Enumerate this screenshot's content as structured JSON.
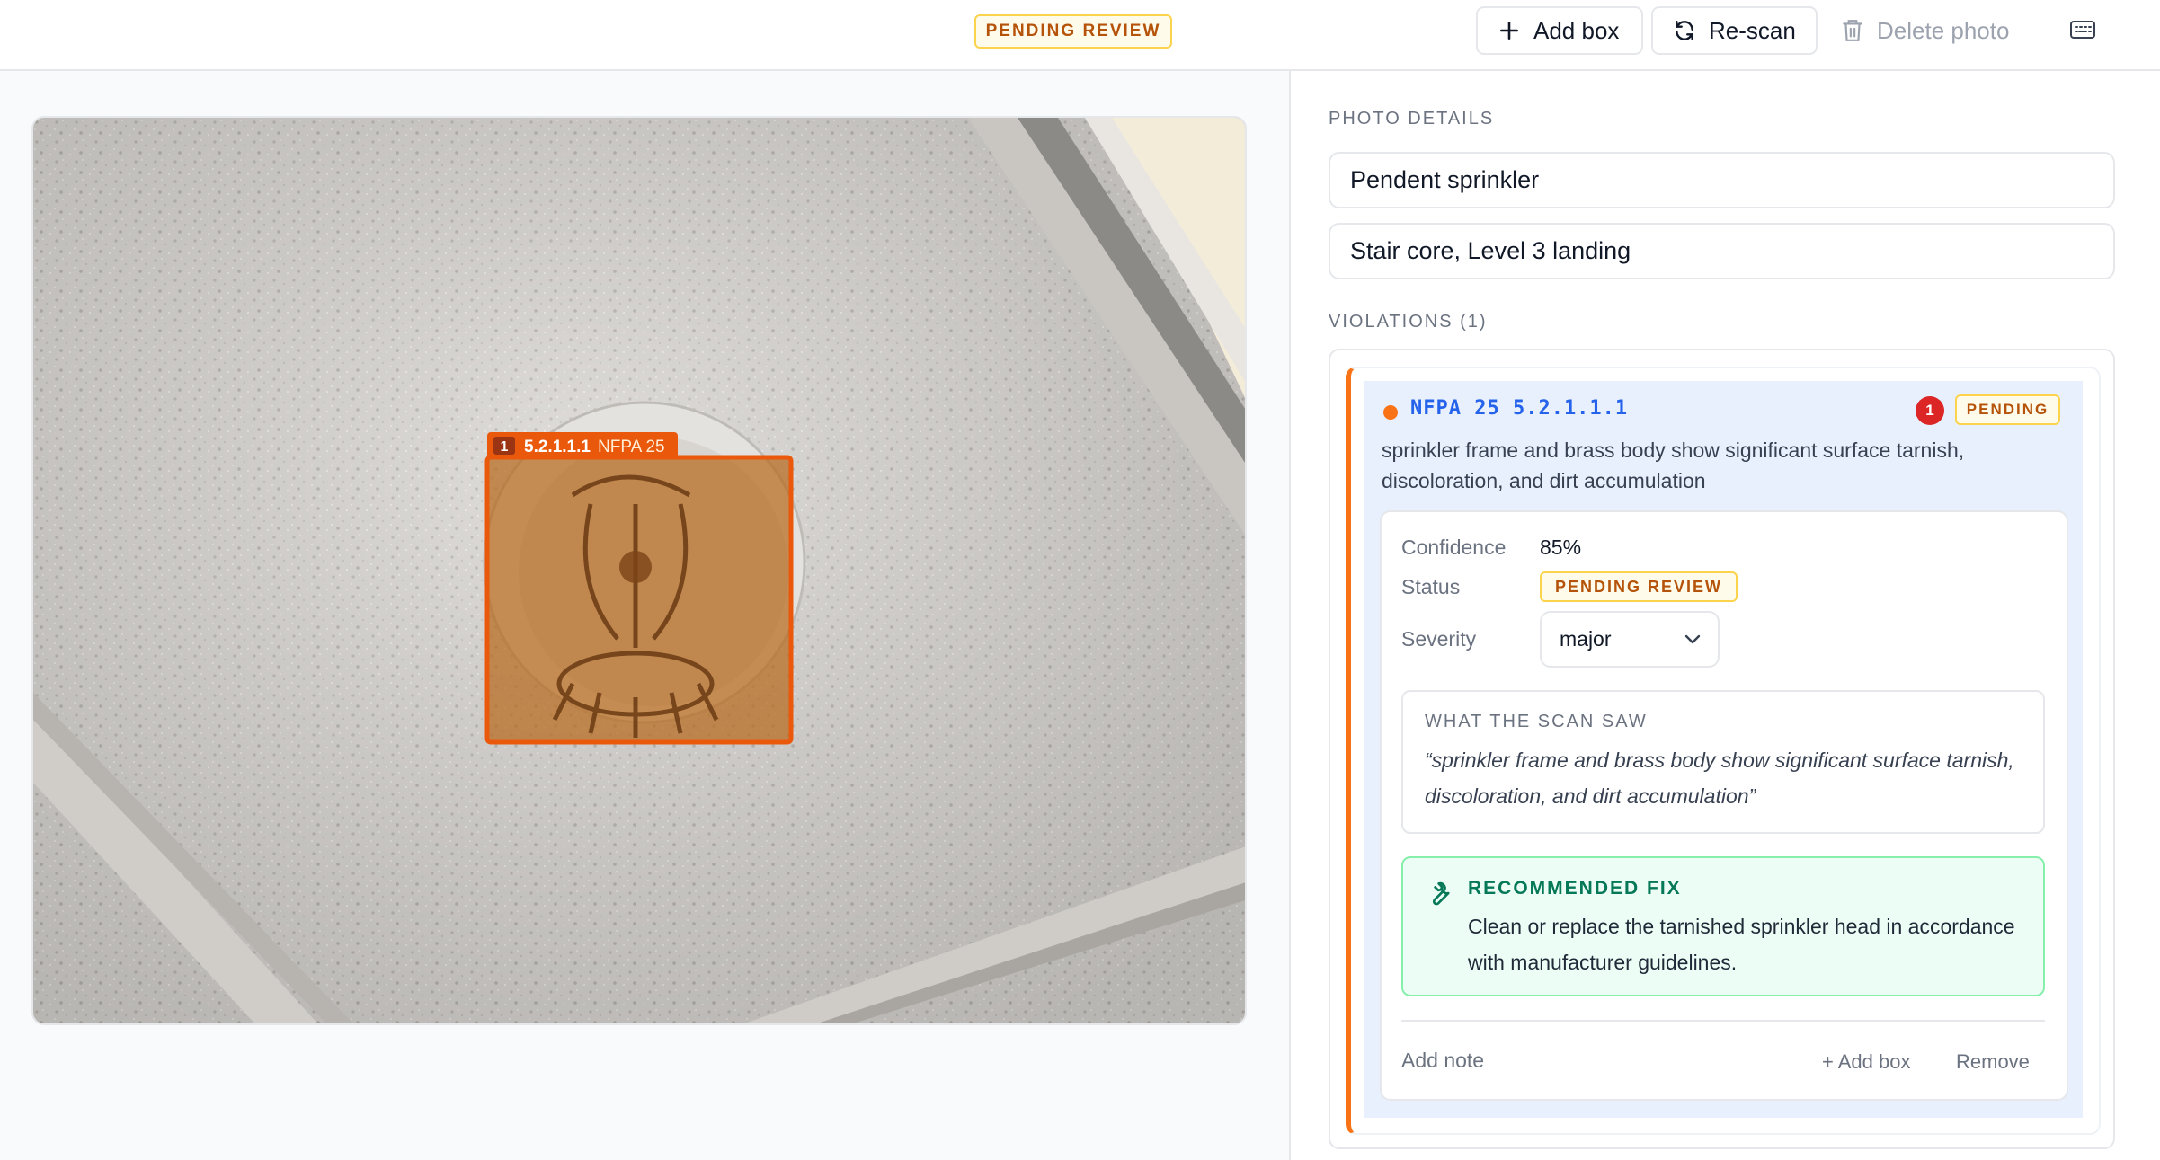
{
  "header": {
    "status_badge": "PENDING REVIEW",
    "add_box_label": "Add box",
    "rescan_label": "Re-scan",
    "delete_label": "Delete photo"
  },
  "photo": {
    "box_index": "1",
    "box_code": "5.2.1.1.1",
    "box_standard": "NFPA 25",
    "box_color": "#ea580c"
  },
  "details": {
    "section_label": "PHOTO DETAILS",
    "name_value": "Pendent sprinkler",
    "location_value": "Stair core, Level 3 landing"
  },
  "violations": {
    "section_label": "VIOLATIONS (1)",
    "items": [
      {
        "code": "NFPA 25 5.2.1.1.1",
        "count": "1",
        "status_short": "PENDING",
        "description": "sprinkler frame and brass body show significant surface tarnish, discoloration, and dirt accumulation",
        "confidence_label": "Confidence",
        "confidence_value": "85%",
        "status_label": "Status",
        "status_value": "PENDING REVIEW",
        "severity_label": "Severity",
        "severity_value": "major",
        "scan_title": "WHAT THE SCAN SAW",
        "scan_quote": "“sprinkler frame and brass body show significant surface tarnish, discoloration, and dirt accumulation”",
        "fix_title": "RECOMMENDED FIX",
        "fix_text": "Clean or replace the tarnished sprinkler head in accordance with manufacturer guidelines.",
        "add_note_label": "Add note",
        "add_box_label": "+ Add box",
        "remove_label": "Remove"
      }
    ]
  },
  "colors": {
    "accent_orange": "#f97316",
    "pending_amber": "#b45309",
    "code_blue": "#2563eb",
    "fix_green": "#047857"
  }
}
